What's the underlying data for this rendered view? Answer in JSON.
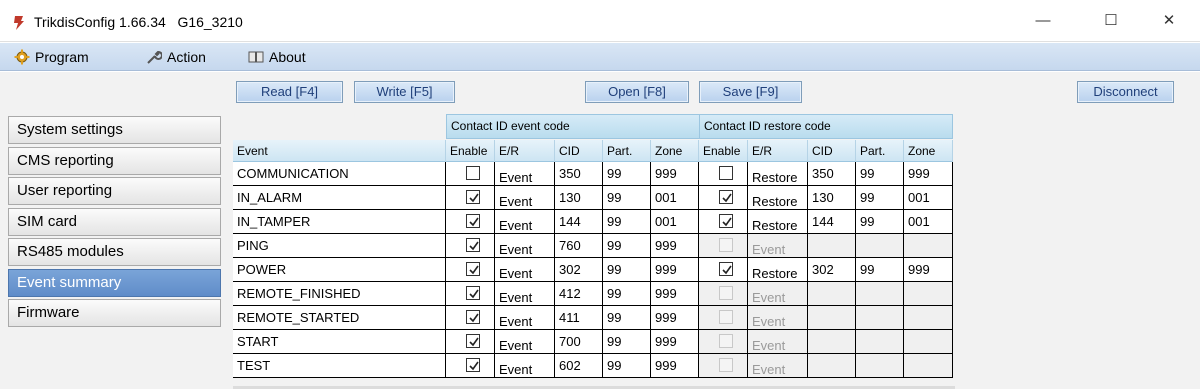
{
  "window": {
    "title": "TrikdisConfig 1.66.34   G16_3210",
    "controls": {
      "minimize": "—",
      "maximize": "☐",
      "close": "✕"
    }
  },
  "menu": {
    "program": "Program",
    "action": "Action",
    "about": "About"
  },
  "toolbar": {
    "read": "Read [F4]",
    "write": "Write [F5]",
    "open": "Open [F8]",
    "save": "Save [F9]",
    "disconnect": "Disconnect"
  },
  "sidebar": {
    "items": [
      {
        "label": "System settings",
        "active": false
      },
      {
        "label": "CMS reporting",
        "active": false
      },
      {
        "label": "User reporting",
        "active": false
      },
      {
        "label": "SIM card",
        "active": false
      },
      {
        "label": "RS485 modules",
        "active": false
      },
      {
        "label": "Event summary",
        "active": true
      },
      {
        "label": "Firmware",
        "active": false
      }
    ]
  },
  "table": {
    "group_event": "Contact ID event code",
    "group_restore": "Contact ID restore code",
    "columns": [
      "Event",
      "Enable",
      "E/R",
      "CID",
      "Part.",
      "Zone",
      "Enable",
      "E/R",
      "CID",
      "Part.",
      "Zone"
    ],
    "rows": [
      {
        "event": "COMMUNICATION",
        "enable": false,
        "er": "Event",
        "cid": "350",
        "part": "99",
        "zone": "999",
        "r_enable": false,
        "r_enabled": true,
        "r_er": "Restore",
        "r_cid": "350",
        "r_part": "99",
        "r_zone": "999"
      },
      {
        "event": "IN_ALARM",
        "enable": true,
        "er": "Event",
        "cid": "130",
        "part": "99",
        "zone": "001",
        "r_enable": true,
        "r_enabled": true,
        "r_er": "Restore",
        "r_cid": "130",
        "r_part": "99",
        "r_zone": "001"
      },
      {
        "event": "IN_TAMPER",
        "enable": true,
        "er": "Event",
        "cid": "144",
        "part": "99",
        "zone": "001",
        "r_enable": true,
        "r_enabled": true,
        "r_er": "Restore",
        "r_cid": "144",
        "r_part": "99",
        "r_zone": "001"
      },
      {
        "event": "PING",
        "enable": true,
        "er": "Event",
        "cid": "760",
        "part": "99",
        "zone": "999",
        "r_enable": false,
        "r_enabled": false,
        "r_er": "Event",
        "r_cid": "",
        "r_part": "",
        "r_zone": ""
      },
      {
        "event": "POWER",
        "enable": true,
        "er": "Event",
        "cid": "302",
        "part": "99",
        "zone": "999",
        "r_enable": true,
        "r_enabled": true,
        "r_er": "Restore",
        "r_cid": "302",
        "r_part": "99",
        "r_zone": "999"
      },
      {
        "event": "REMOTE_FINISHED",
        "enable": true,
        "er": "Event",
        "cid": "412",
        "part": "99",
        "zone": "999",
        "r_enable": false,
        "r_enabled": false,
        "r_er": "Event",
        "r_cid": "",
        "r_part": "",
        "r_zone": ""
      },
      {
        "event": "REMOTE_STARTED",
        "enable": true,
        "er": "Event",
        "cid": "411",
        "part": "99",
        "zone": "999",
        "r_enable": false,
        "r_enabled": false,
        "r_er": "Event",
        "r_cid": "",
        "r_part": "",
        "r_zone": ""
      },
      {
        "event": "START",
        "enable": true,
        "er": "Event",
        "cid": "700",
        "part": "99",
        "zone": "999",
        "r_enable": false,
        "r_enabled": false,
        "r_er": "Event",
        "r_cid": "",
        "r_part": "",
        "r_zone": ""
      },
      {
        "event": "TEST",
        "enable": true,
        "er": "Event",
        "cid": "602",
        "part": "99",
        "zone": "999",
        "r_enable": false,
        "r_enabled": false,
        "r_er": "Event",
        "r_cid": "",
        "r_part": "",
        "r_zone": ""
      }
    ]
  },
  "icons": {
    "app": "trikdis-app-icon",
    "program": "gear-icon",
    "action": "wrench-icon",
    "about": "book-icon",
    "check": "checkmark-icon"
  },
  "colors": {
    "accent": "#5f8cc9",
    "header_blue": "#c6dff0",
    "button_text": "#1f3f7a",
    "app_icon": "#c0392b"
  }
}
